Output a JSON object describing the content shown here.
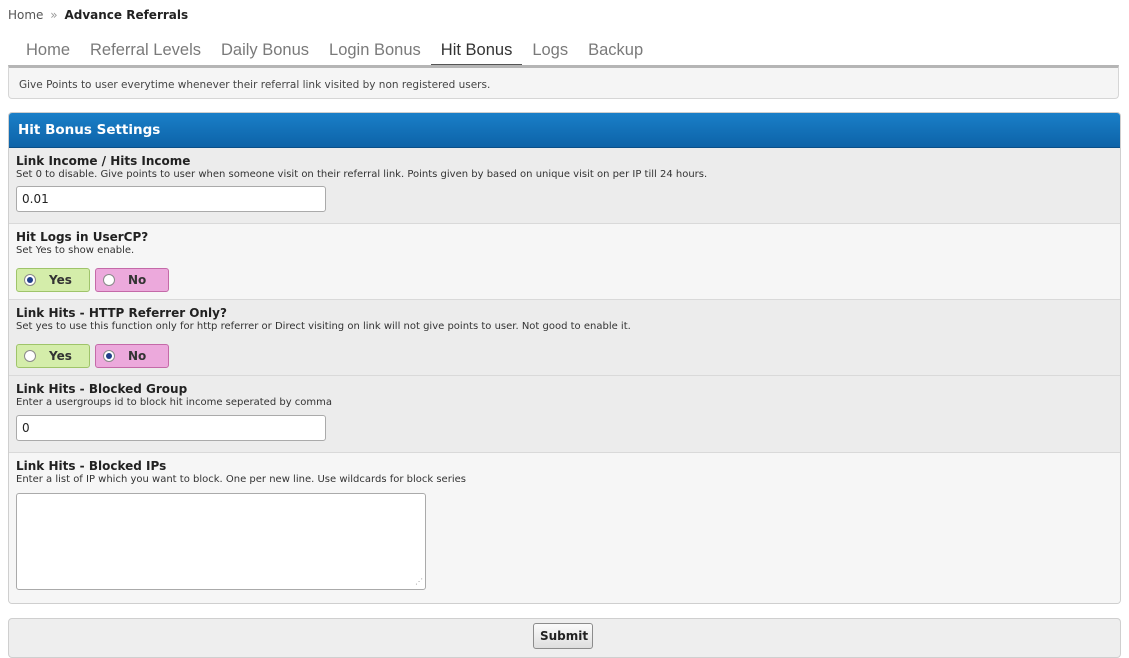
{
  "breadcrumb": {
    "home": "Home",
    "separator": "»",
    "current": "Advance Referrals"
  },
  "tabs": [
    {
      "label": "Home",
      "active": false
    },
    {
      "label": "Referral Levels",
      "active": false
    },
    {
      "label": "Daily Bonus",
      "active": false
    },
    {
      "label": "Login Bonus",
      "active": false
    },
    {
      "label": "Hit Bonus",
      "active": true
    },
    {
      "label": "Logs",
      "active": false
    },
    {
      "label": "Backup",
      "active": false
    }
  ],
  "description": "Give Points to user everytime whenever their referral link visited by non registered users.",
  "settings": {
    "header": "Hit Bonus Settings",
    "link_income": {
      "title": "Link Income / Hits Income",
      "desc": "Set 0 to disable. Give points to user when someone visit on their referral link. Points given by based on unique visit on per IP till 24 hours.",
      "value": "0.01"
    },
    "hit_logs": {
      "title": "Hit Logs in UserCP?",
      "desc": "Set Yes to show enable.",
      "yes_label": "Yes",
      "no_label": "No",
      "selected": "yes"
    },
    "http_referrer": {
      "title": "Link Hits - HTTP Referrer Only?",
      "desc": "Set yes to use this function only for http referrer or Direct visiting on link will not give points to user. Not good to enable it.",
      "yes_label": "Yes",
      "no_label": "No",
      "selected": "no"
    },
    "blocked_group": {
      "title": "Link Hits - Blocked Group",
      "desc": "Enter a usergroups id to block hit income seperated by comma",
      "value": "0"
    },
    "blocked_ips": {
      "title": "Link Hits - Blocked IPs",
      "desc": "Enter a list of IP which you want to block. One per new line. Use wildcards for block series",
      "value": ""
    }
  },
  "submit_label": "Submit",
  "colors": {
    "header_blue": "#0d63a8",
    "yes_green": "#d4edaa",
    "no_pink": "#eca9dc"
  }
}
